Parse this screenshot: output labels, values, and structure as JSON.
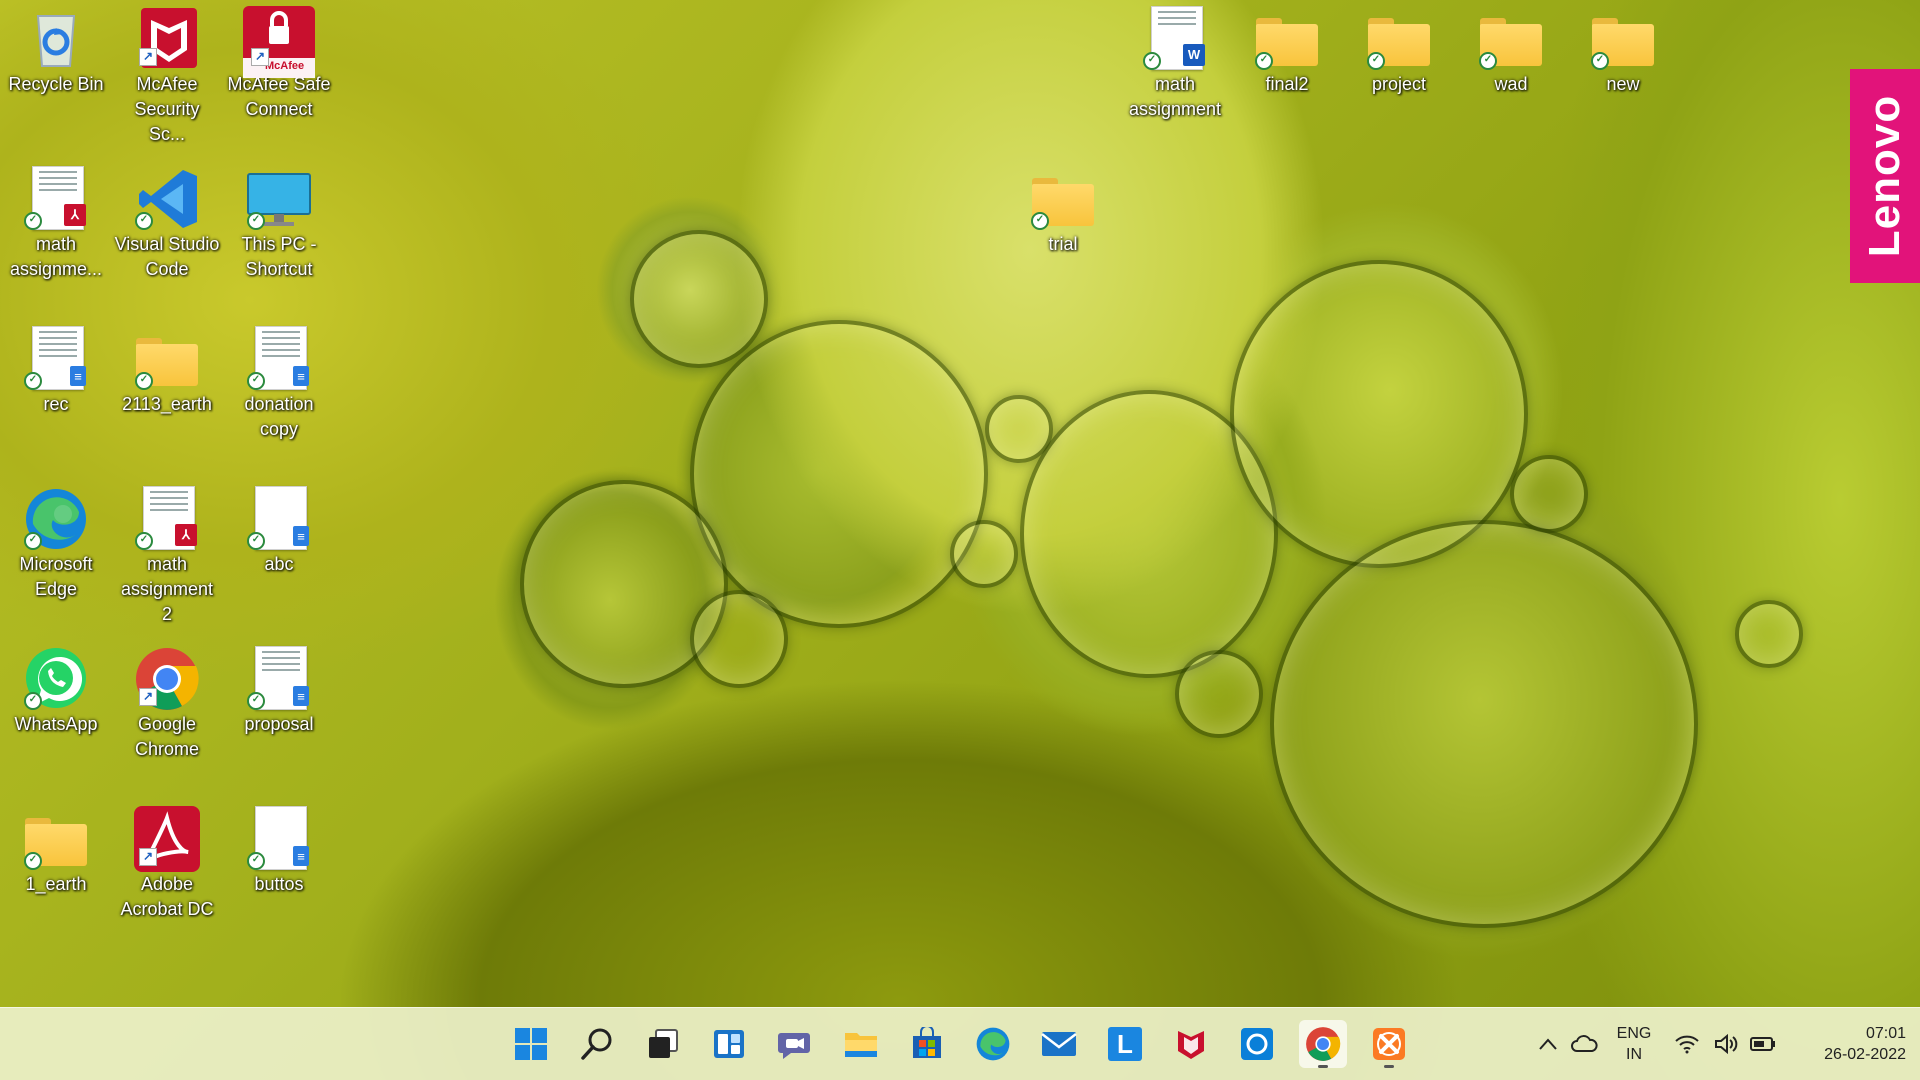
{
  "desktop": {
    "icons": [
      {
        "label": "Recycle Bin"
      },
      {
        "label": "McAfee Security Sc...",
        "badge": "McAfee"
      },
      {
        "label": "McAfee Safe Connect",
        "badge": "McAfee"
      },
      {
        "label": "math assignme..."
      },
      {
        "label": "Visual Studio Code"
      },
      {
        "label": "This PC - Shortcut"
      },
      {
        "label": "rec"
      },
      {
        "label": "2113_earth"
      },
      {
        "label": "donation copy"
      },
      {
        "label": "Microsoft Edge"
      },
      {
        "label": "math assignment 2"
      },
      {
        "label": "abc"
      },
      {
        "label": "WhatsApp"
      },
      {
        "label": "Google Chrome"
      },
      {
        "label": "proposal"
      },
      {
        "label": "1_earth"
      },
      {
        "label": "Adobe Acrobat DC"
      },
      {
        "label": "buttos"
      },
      {
        "label": "math assignment"
      },
      {
        "label": "final2"
      },
      {
        "label": "project"
      },
      {
        "label": "wad"
      },
      {
        "label": "new"
      },
      {
        "label": "trial"
      }
    ],
    "brand_tab": "Lenovo",
    "brand_color": "#e2137a"
  },
  "taskbar": {
    "apps": [
      {
        "icon": "windows-start-icon"
      },
      {
        "icon": "search-icon"
      },
      {
        "icon": "task-view-icon"
      },
      {
        "icon": "widgets-icon"
      },
      {
        "icon": "teams-chat-icon"
      },
      {
        "icon": "file-explorer-icon"
      },
      {
        "icon": "microsoft-store-icon"
      },
      {
        "icon": "edge-icon"
      },
      {
        "icon": "mail-icon"
      },
      {
        "icon": "lenovo-vantage-icon",
        "glyph": "L"
      },
      {
        "icon": "mcafee-icon"
      },
      {
        "icon": "cortana-icon"
      },
      {
        "icon": "chrome-icon"
      },
      {
        "icon": "xampp-icon"
      }
    ],
    "tray": {
      "lang_line1": "ENG",
      "lang_line2": "IN",
      "time": "07:01",
      "date": "26-02-2022"
    }
  }
}
